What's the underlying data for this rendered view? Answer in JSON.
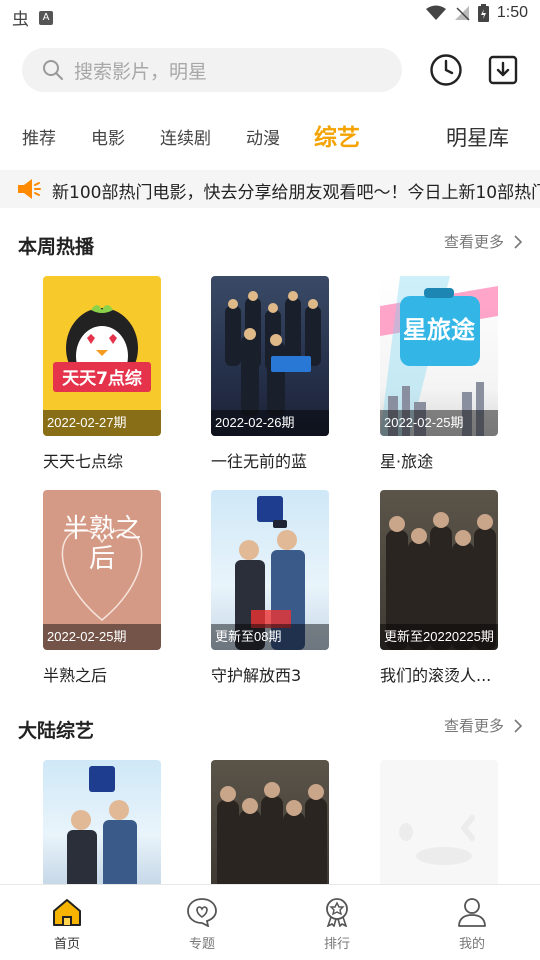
{
  "status_bar": {
    "time": "1:50",
    "left_glyph": "虫",
    "a_badge": "A"
  },
  "search": {
    "placeholder": "搜索影片，明星"
  },
  "tabs": [
    {
      "label": "推荐"
    },
    {
      "label": "电影"
    },
    {
      "label": "连续剧"
    },
    {
      "label": "动漫"
    },
    {
      "label": "综艺",
      "active": true
    },
    {
      "label": "明星库"
    }
  ],
  "notice": {
    "text": "新100部热门电影，快去分享给朋友观看吧～！今日上新10部热门"
  },
  "sections": [
    {
      "title": "本周热播",
      "more": "查看更多",
      "items": [
        {
          "name": "天天七点综",
          "badge": "2022-02-27期",
          "poster_text": "天天7点综"
        },
        {
          "name": "一往无前的蓝",
          "badge": "2022-02-26期",
          "poster_text": ""
        },
        {
          "name": "星·旅途",
          "badge": "2022-02-25期",
          "poster_text": "星旅途"
        },
        {
          "name": "半熟之后",
          "badge": "2022-02-25期",
          "poster_text": "半熟之后"
        },
        {
          "name": "守护解放西3",
          "badge": "更新至08期",
          "poster_text": ""
        },
        {
          "name": "我们的滚烫人...",
          "badge": "更新至20220225期",
          "poster_text": ""
        }
      ]
    },
    {
      "title": "大陆综艺",
      "more": "查看更多",
      "items": [
        {
          "name": "",
          "badge": ""
        },
        {
          "name": "",
          "badge": ""
        },
        {
          "name": "",
          "badge": ""
        }
      ]
    }
  ],
  "bottom_nav": [
    {
      "label": "首页",
      "icon": "home-icon",
      "active": true
    },
    {
      "label": "专题",
      "icon": "heart-bubble-icon"
    },
    {
      "label": "排行",
      "icon": "medal-icon"
    },
    {
      "label": "我的",
      "icon": "user-icon"
    }
  ],
  "colors": {
    "accent": "#f5a300",
    "notice_icon": "#ff8a00"
  }
}
